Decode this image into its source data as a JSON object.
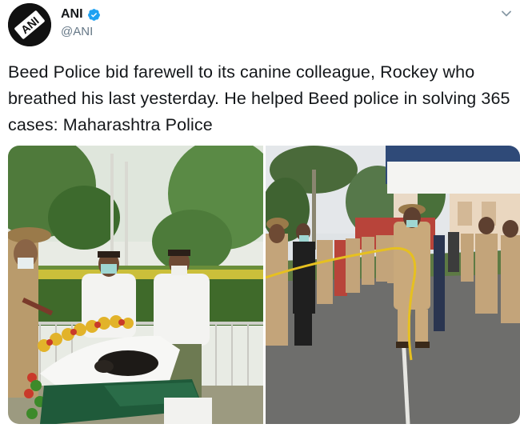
{
  "tweet": {
    "author": {
      "display_name": "ANI",
      "handle": "@ANI",
      "avatar_text": "ANI",
      "verified": true,
      "avatar_icon": "ani-logo-icon",
      "verified_icon": "verified-badge-icon"
    },
    "menu_icon": "chevron-down-icon",
    "text": "Beed Police bid farewell to its canine colleague, Rockey who breathed his last yesterday. He helped Beed police in solving 365 cases: Maharashtra Police",
    "media": {
      "count": 2
    }
  },
  "colors": {
    "verified_blue": "#1da1f2",
    "handle_gray": "#657786",
    "text_dark": "#14171a"
  }
}
